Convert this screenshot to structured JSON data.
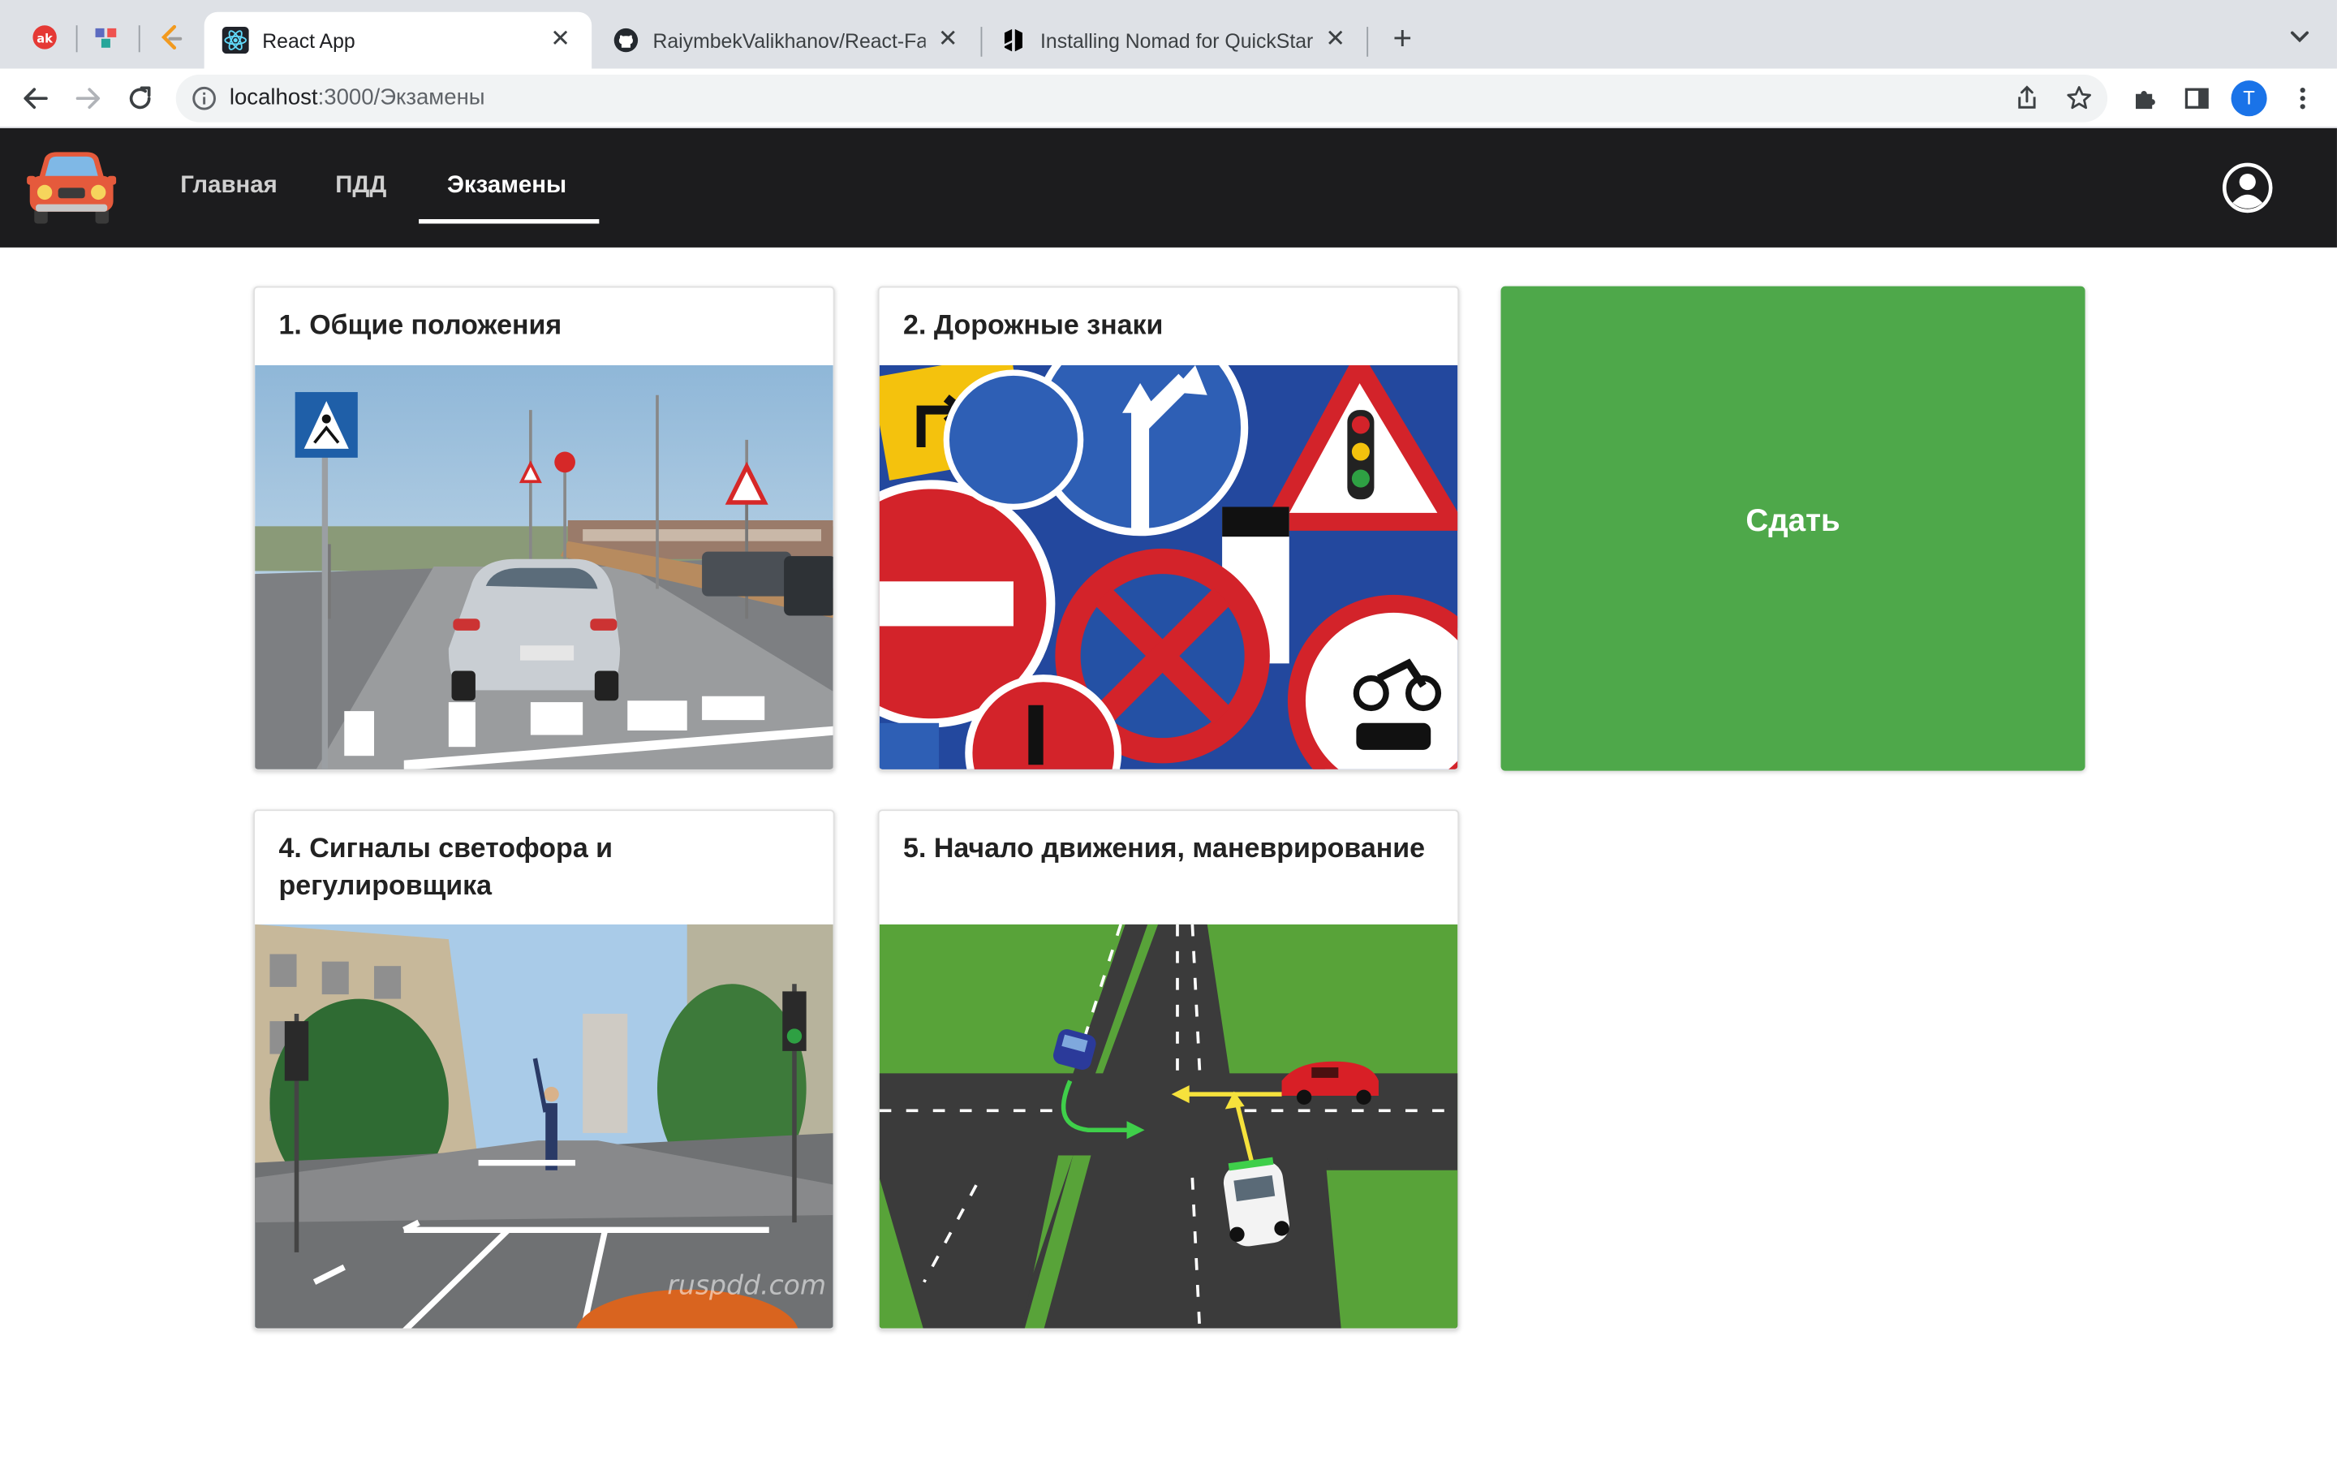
{
  "browser": {
    "tabs": [
      {
        "title": "React App",
        "favicon": "react-icon",
        "active": true
      },
      {
        "title": "RaiymbekValikhanov/React-Fal",
        "favicon": "github-icon",
        "active": false
      },
      {
        "title": "Installing Nomad for QuickStar",
        "favicon": "hashicorp-icon",
        "active": false
      }
    ],
    "pinned_tabs": [
      "pinned-red-icon",
      "pinned-dots-icon",
      "pinned-leetcode-icon"
    ],
    "url_host": "localhost",
    "url_path": ":3000/Экзамены",
    "profile_initial": "T"
  },
  "nav": {
    "items": [
      {
        "label": "Главная",
        "active": false
      },
      {
        "label": "ПДД",
        "active": false
      },
      {
        "label": "Экзамены",
        "active": true
      }
    ]
  },
  "exams": {
    "cards": [
      {
        "title": "1. Общие положения",
        "image": "driving-school-road-image"
      },
      {
        "title": "2. Дорожные знаки",
        "image": "road-signs-image"
      },
      {
        "title": "4. Сигналы светофора и регулировщика",
        "image": "traffic-controller-street-image"
      },
      {
        "title": "5. Начало движения, маневрирование",
        "image": "intersection-diagram-image"
      }
    ],
    "submit_label": "Сдать",
    "watermark": "ruspdd.com"
  },
  "colors": {
    "appbar": "#1c1c1e",
    "submit_green": "#4ea84a",
    "tabbar": "#dee1e6"
  }
}
